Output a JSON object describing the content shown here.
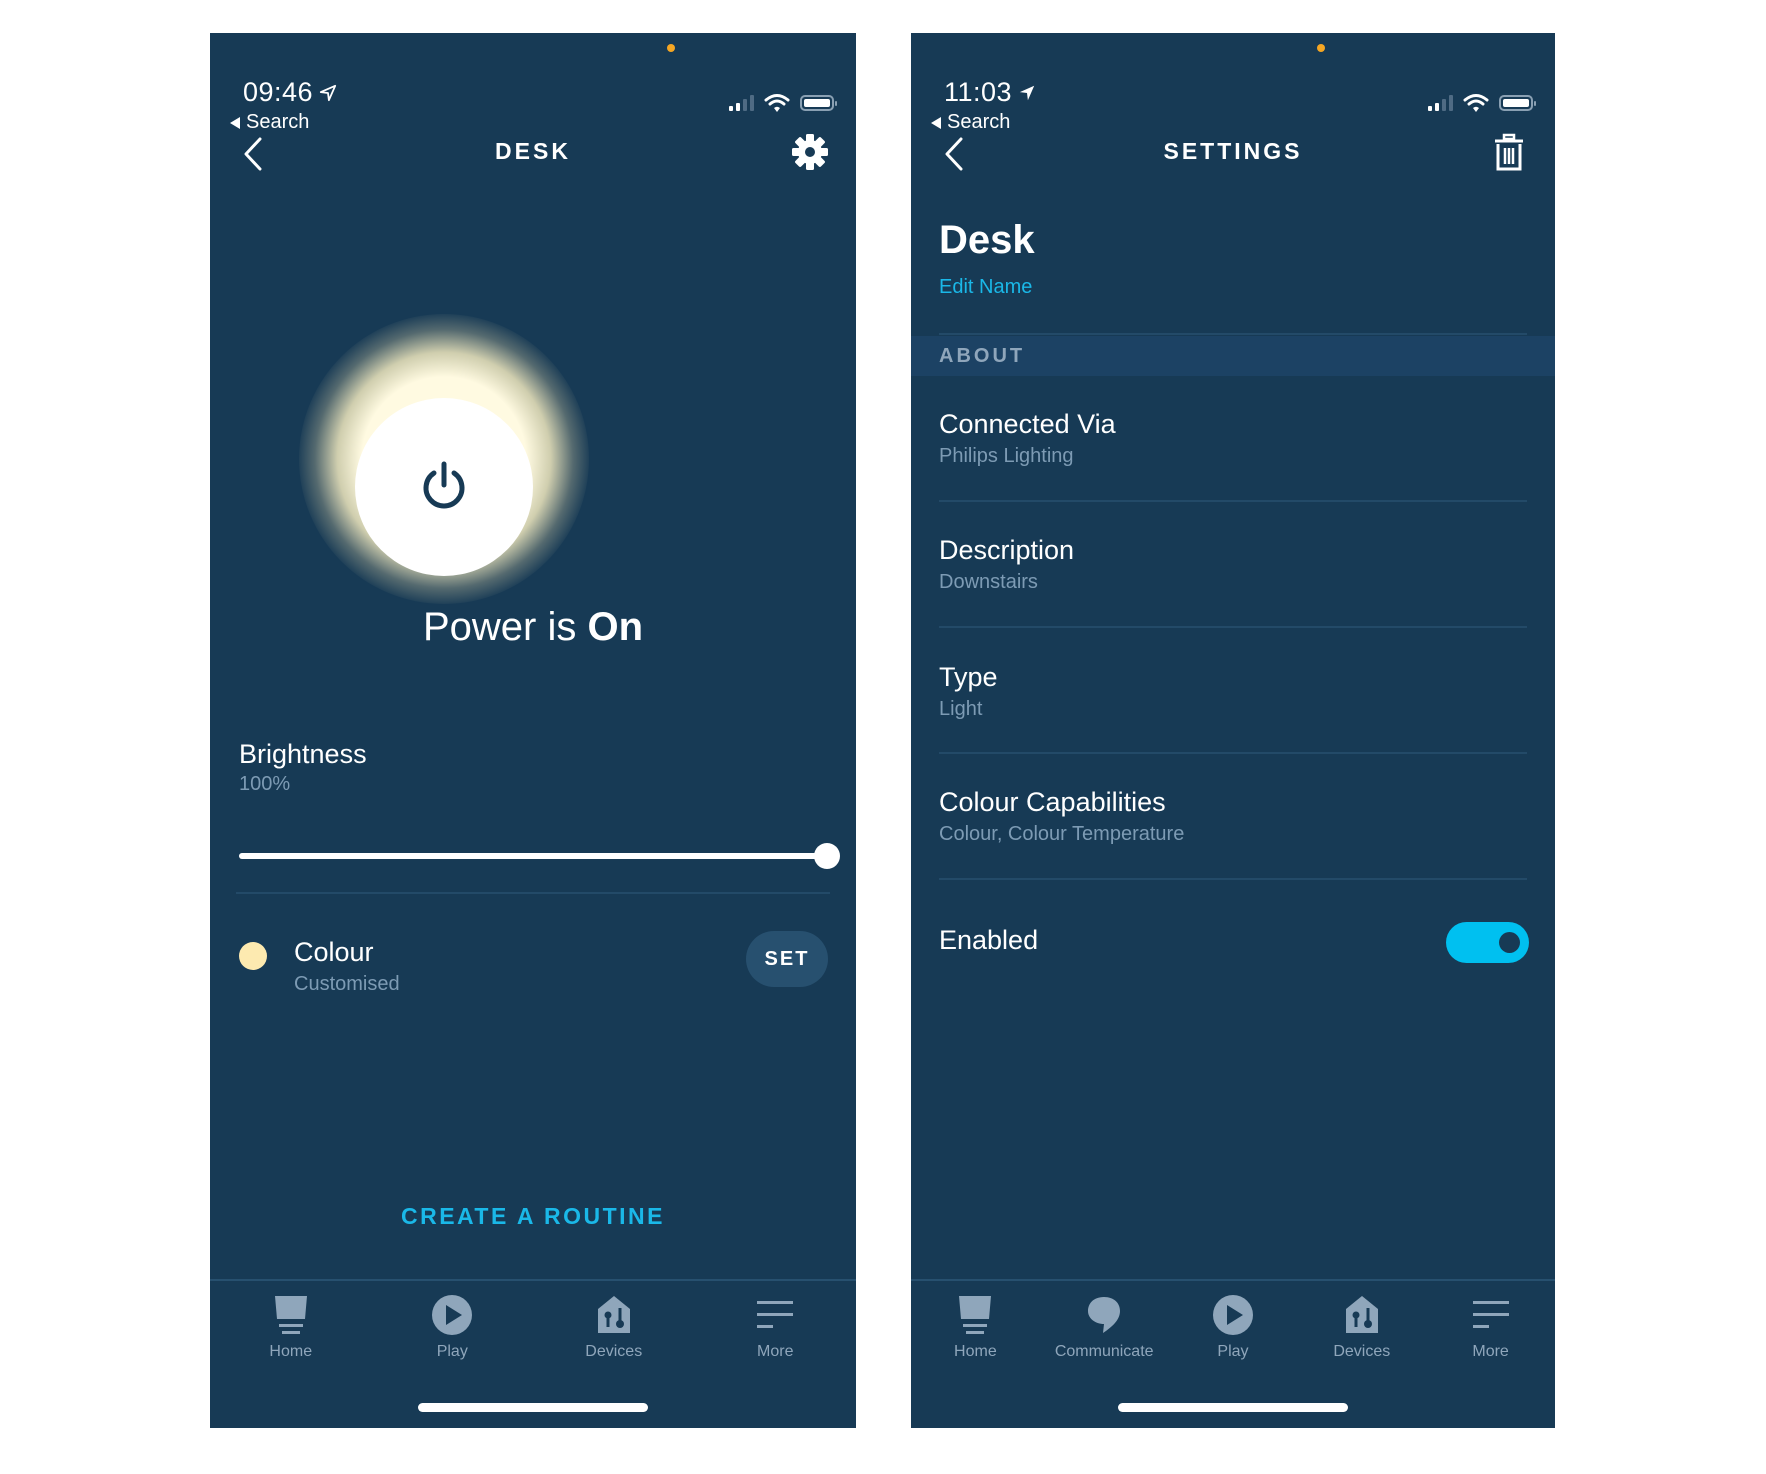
{
  "left_screen": {
    "status_bar": {
      "time": "09:46",
      "back_app": "Search"
    },
    "nav": {
      "title": "DESK",
      "back_icon": "chevron-left-icon",
      "right_icon": "gear-icon"
    },
    "power": {
      "prefix": "Power is ",
      "state": "On",
      "icon": "power-icon"
    },
    "brightness": {
      "label": "Brightness",
      "value": "100%",
      "percent": 100
    },
    "colour": {
      "label": "Colour",
      "value": "Customised",
      "swatch": "#fdeab0",
      "button": "SET"
    },
    "routine_link": "CREATE A ROUTINE",
    "tabs": [
      {
        "label": "Home",
        "icon": "home-icon"
      },
      {
        "label": "Play",
        "icon": "play-icon"
      },
      {
        "label": "Devices",
        "icon": "devices-icon"
      },
      {
        "label": "More",
        "icon": "menu-icon"
      }
    ]
  },
  "right_screen": {
    "status_bar": {
      "time": "11:03",
      "back_app": "Search"
    },
    "nav": {
      "title": "SETTINGS",
      "back_icon": "chevron-left-icon",
      "right_icon": "trash-icon"
    },
    "device_name": "Desk",
    "edit_name": "Edit Name",
    "section": "ABOUT",
    "rows": [
      {
        "label": "Connected Via",
        "value": "Philips Lighting"
      },
      {
        "label": "Description",
        "value": "Downstairs"
      },
      {
        "label": "Type",
        "value": "Light"
      },
      {
        "label": "Colour Capabilities",
        "value": "Colour, Colour Temperature"
      }
    ],
    "enabled": {
      "label": "Enabled",
      "on": true
    },
    "tabs": [
      {
        "label": "Home",
        "icon": "home-icon"
      },
      {
        "label": "Communicate",
        "icon": "chat-icon"
      },
      {
        "label": "Play",
        "icon": "play-icon"
      },
      {
        "label": "Devices",
        "icon": "devices-icon"
      },
      {
        "label": "More",
        "icon": "menu-icon"
      }
    ]
  },
  "colors": {
    "background": "#173a55",
    "accent": "#1ab8e8",
    "toggle_on": "#00c0f0",
    "section_band": "#1c4264"
  }
}
